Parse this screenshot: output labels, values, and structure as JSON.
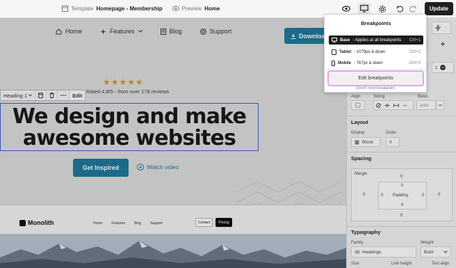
{
  "topbar": {
    "template_label": "Template",
    "template_name": "Homepage - Membership",
    "preview_label": "Preview",
    "preview_name": "Home",
    "update_label": "Update"
  },
  "site_nav": {
    "items": [
      {
        "label": "Home",
        "icon": "home-icon"
      },
      {
        "label": "Features",
        "icon": "sparkle-icon"
      },
      {
        "label": "Blog",
        "icon": "document-icon"
      },
      {
        "label": "Support",
        "icon": "support-icon"
      }
    ],
    "download_label": "Download"
  },
  "hero": {
    "stars": "★★★★★",
    "rating_text": "Rated 4.8/5 - from over 178 reviews",
    "title_line1": "We design and make",
    "title_line2": "awesome websites",
    "cta_label": "Get Inspired",
    "watch_label": "Watch video"
  },
  "element_toolbar": {
    "element_label": "Heading 1",
    "edit_label": "Edit"
  },
  "preview_site": {
    "logo": "Monolith",
    "nav": [
      "Home",
      "Features",
      "Blog",
      "Support"
    ],
    "contact_label": "Contact",
    "pricing_label": "Pricing"
  },
  "breakpoints": {
    "title": "Breakpoints",
    "items": [
      {
        "name": "Base",
        "desc": "- Applies at all breakpoints",
        "shortcut": "Ctrl+1",
        "icon": "desktop-icon",
        "active": true
      },
      {
        "name": "Tablet",
        "desc": "- 1079px & down",
        "shortcut": "Ctrl+2",
        "icon": "tablet-icon",
        "active": false
      },
      {
        "name": "Mobile",
        "desc": "- 767px & down",
        "shortcut": "Ctrl+3",
        "icon": "mobile-icon",
        "active": false
      }
    ],
    "edit_label": "Edit breakpoints",
    "hint": "Ctrl+0: next breakpoint"
  },
  "panel": {
    "align_label": "Align",
    "sizing_label": "Sizing",
    "basis_label": "Basis",
    "basis_value": "auto",
    "layout_title": "Layout",
    "display_label": "Display",
    "display_value": "Block",
    "order_label": "Order",
    "order_value": "0",
    "spacing_title": "Spacing",
    "margin_label": "Margin",
    "padding_label": "Padding",
    "margin_top": "0",
    "margin_left": "0",
    "margin_right": "0",
    "margin_bottom": "0",
    "padding_top": "0",
    "padding_left": "0",
    "padding_right": "0",
    "padding_bottom": "0",
    "typography_title": "Typography",
    "family_label": "Family",
    "family_value": "Headings",
    "weight_label": "Weight",
    "weight_value": "Bold",
    "size_label": "Size",
    "line_height_label": "Line height",
    "text_align_label": "Text align",
    "top_number": "1"
  },
  "colors": {
    "accent": "#1e7a9c",
    "star": "#d19b2b",
    "selection": "#3e61c9",
    "highlight": "#e5a5e5"
  }
}
